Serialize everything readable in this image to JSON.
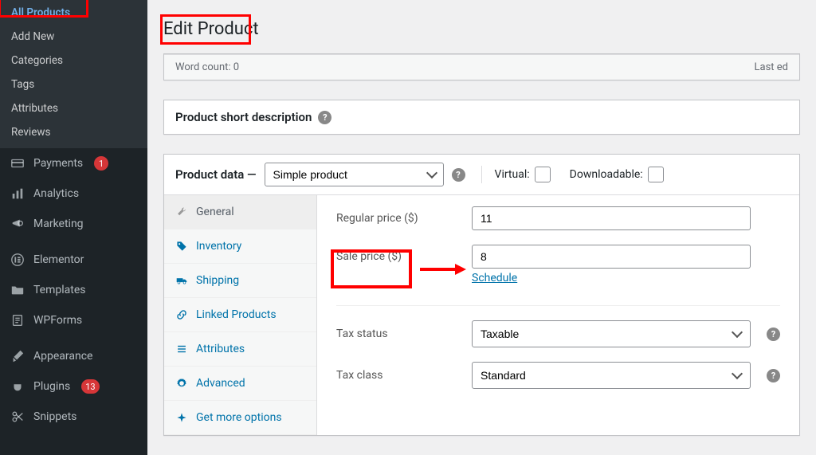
{
  "sidebar": {
    "submenu": [
      {
        "label": "All Products"
      },
      {
        "label": "Add New"
      },
      {
        "label": "Categories"
      },
      {
        "label": "Tags"
      },
      {
        "label": "Attributes"
      },
      {
        "label": "Reviews"
      }
    ],
    "items": [
      {
        "label": "Payments",
        "badge": 1
      },
      {
        "label": "Analytics"
      },
      {
        "label": "Marketing"
      },
      {
        "label": "Elementor"
      },
      {
        "label": "Templates"
      },
      {
        "label": "WPForms"
      },
      {
        "label": "Appearance"
      },
      {
        "label": "Plugins",
        "badge": 13
      },
      {
        "label": "Snippets"
      }
    ]
  },
  "header": {
    "title": "Edit Product"
  },
  "editor_status": {
    "word_count": "Word count: 0",
    "last_edited": "Last ed"
  },
  "short_desc": {
    "title": "Product short description"
  },
  "product_data": {
    "heading": "Product data —",
    "type_selected": "Simple product",
    "virtual_label": "Virtual:",
    "downloadable_label": "Downloadable:",
    "tabs": [
      {
        "label": "General"
      },
      {
        "label": "Inventory"
      },
      {
        "label": "Shipping"
      },
      {
        "label": "Linked Products"
      },
      {
        "label": "Attributes"
      },
      {
        "label": "Advanced"
      },
      {
        "label": "Get more options"
      }
    ],
    "fields": {
      "regular_label": "Regular price ($)",
      "regular_value": "11",
      "sale_label": "Sale price ($)",
      "sale_value": "8",
      "schedule": "Schedule",
      "tax_status_label": "Tax status",
      "tax_status_value": "Taxable",
      "tax_class_label": "Tax class",
      "tax_class_value": "Standard"
    }
  }
}
